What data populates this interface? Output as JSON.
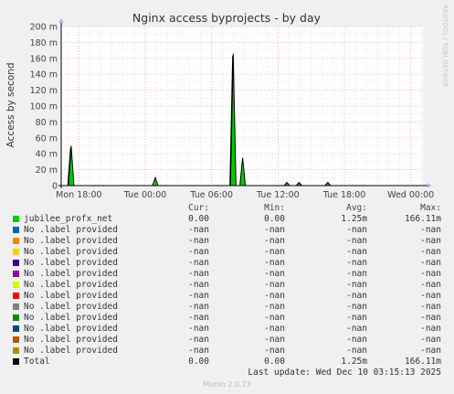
{
  "chart_data": {
    "type": "area",
    "title": "Nginx access byprojects - by day",
    "ylabel": "Access by second",
    "xlabel": "",
    "watermark": "RRDTOOL / TOBI OETIKER",
    "ylim": [
      0,
      200
    ],
    "y_unit": "m",
    "y_ticks": [
      0,
      20,
      40,
      60,
      80,
      100,
      120,
      140,
      160,
      180,
      200
    ],
    "y_tick_labels": [
      "0",
      "20 m",
      "40 m",
      "60 m",
      "80 m",
      "100 m",
      "120 m",
      "140 m",
      "160 m",
      "180 m",
      "200 m"
    ],
    "x_range_hours": [
      -1.6,
      31.1
    ],
    "x_tick_hours": [
      0,
      6,
      12,
      18,
      24,
      30
    ],
    "x_tick_labels": [
      "Mon 18:00",
      "Tue 00:00",
      "Tue 06:00",
      "Tue 12:00",
      "Tue 18:00",
      "Wed 00:00"
    ],
    "series": [
      {
        "name": "jubilee_profx_net",
        "color": "#00cc00",
        "peaks": [
          {
            "x": -0.75,
            "y": 48
          },
          {
            "x": -0.7,
            "y": 50
          },
          {
            "x": 6.9,
            "y": 10
          },
          {
            "x": 13.9,
            "y": 163
          },
          {
            "x": 13.95,
            "y": 166
          },
          {
            "x": 14.8,
            "y": 35
          },
          {
            "x": 18.8,
            "y": 4
          },
          {
            "x": 19.9,
            "y": 4
          },
          {
            "x": 22.5,
            "y": 4
          }
        ]
      }
    ],
    "total_color": "#000000"
  },
  "legend": {
    "headers": {
      "cur": "Cur:",
      "min": "Min:",
      "avg": "Avg:",
      "max": "Max:"
    },
    "rows": [
      {
        "name": "jubilee_profx_net",
        "color": "#00cc00",
        "cur": "0.00",
        "min": "0.00",
        "avg": "1.25m",
        "max": "166.11m"
      },
      {
        "name": "No .label provided",
        "color": "#0066b3",
        "cur": "-nan",
        "min": "-nan",
        "avg": "-nan",
        "max": "-nan"
      },
      {
        "name": "No .label provided",
        "color": "#ff8000",
        "cur": "-nan",
        "min": "-nan",
        "avg": "-nan",
        "max": "-nan"
      },
      {
        "name": "No .label provided",
        "color": "#ffcc00",
        "cur": "-nan",
        "min": "-nan",
        "avg": "-nan",
        "max": "-nan"
      },
      {
        "name": "No .label provided",
        "color": "#330099",
        "cur": "-nan",
        "min": "-nan",
        "avg": "-nan",
        "max": "-nan"
      },
      {
        "name": "No .label provided",
        "color": "#990099",
        "cur": "-nan",
        "min": "-nan",
        "avg": "-nan",
        "max": "-nan"
      },
      {
        "name": "No .label provided",
        "color": "#ccff00",
        "cur": "-nan",
        "min": "-nan",
        "avg": "-nan",
        "max": "-nan"
      },
      {
        "name": "No .label provided",
        "color": "#ff0000",
        "cur": "-nan",
        "min": "-nan",
        "avg": "-nan",
        "max": "-nan"
      },
      {
        "name": "No .label provided",
        "color": "#808080",
        "cur": "-nan",
        "min": "-nan",
        "avg": "-nan",
        "max": "-nan"
      },
      {
        "name": "No .label provided",
        "color": "#008f00",
        "cur": "-nan",
        "min": "-nan",
        "avg": "-nan",
        "max": "-nan"
      },
      {
        "name": "No .label provided",
        "color": "#00487d",
        "cur": "-nan",
        "min": "-nan",
        "avg": "-nan",
        "max": "-nan"
      },
      {
        "name": "No .label provided",
        "color": "#b35a00",
        "cur": "-nan",
        "min": "-nan",
        "avg": "-nan",
        "max": "-nan"
      },
      {
        "name": "No .label provided",
        "color": "#b38f00",
        "cur": "-nan",
        "min": "-nan",
        "avg": "-nan",
        "max": "-nan"
      },
      {
        "name": "Total",
        "color": "#000000",
        "cur": "0.00",
        "min": "0.00",
        "avg": "1.25m",
        "max": "166.11m"
      }
    ]
  },
  "footer": {
    "last_update": "Last update: Wed Dec 10 03:15:13 2025",
    "version": "Munin 2.0.73"
  }
}
